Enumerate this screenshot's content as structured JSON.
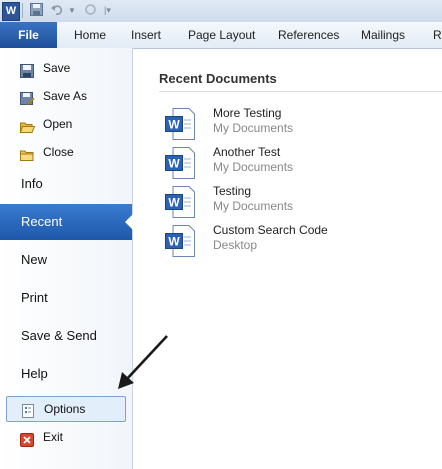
{
  "quick_access": {
    "app_icon": "word-logo-icon",
    "buttons": [
      "save-icon",
      "undo-icon",
      "redo-icon",
      "customize-qat-icon"
    ]
  },
  "ribbon": {
    "file_tab": "File",
    "tabs": [
      "Home",
      "Insert",
      "Page Layout",
      "References",
      "Mailings",
      "R"
    ]
  },
  "nav": {
    "save": "Save",
    "save_as": "Save As",
    "open": "Open",
    "close": "Close",
    "info": "Info",
    "recent": "Recent",
    "new": "New",
    "print": "Print",
    "save_send": "Save & Send",
    "help": "Help",
    "options": "Options",
    "exit": "Exit"
  },
  "recent": {
    "title": "Recent Documents",
    "documents": [
      {
        "name": "More Testing",
        "location": "My Documents"
      },
      {
        "name": "Another Test",
        "location": "My Documents"
      },
      {
        "name": "Testing",
        "location": "My Documents"
      },
      {
        "name": "Custom Search Code",
        "location": "Desktop"
      }
    ]
  },
  "colors": {
    "accent": "#2a5fad",
    "selected": "#2a6ac1"
  }
}
